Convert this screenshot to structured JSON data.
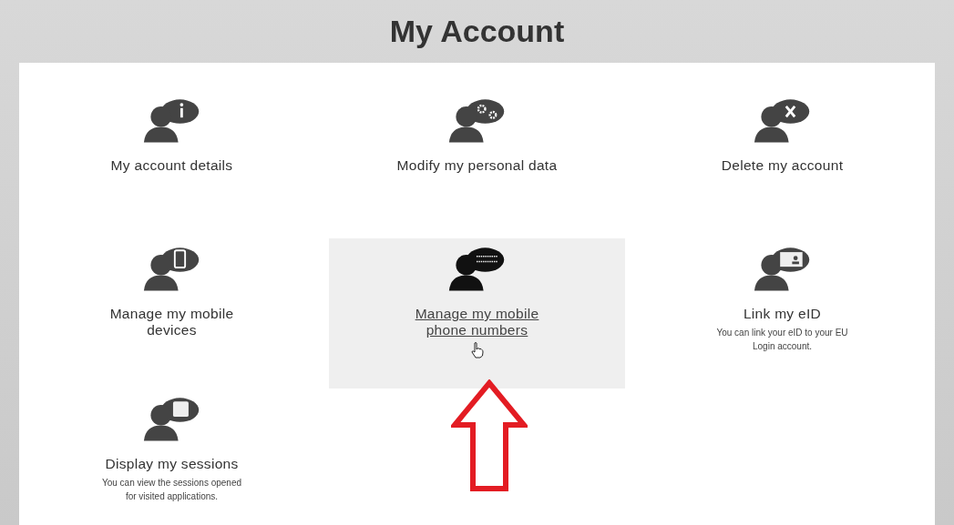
{
  "header": {
    "title": "My Account"
  },
  "tiles": [
    {
      "kind": "info",
      "title": "My account details",
      "selected": false
    },
    {
      "kind": "settings",
      "title": "Modify my personal data",
      "selected": false
    },
    {
      "kind": "delete",
      "title": "Delete my account",
      "selected": false
    },
    {
      "kind": "device",
      "title": "Manage my mobile devices",
      "selected": false
    },
    {
      "kind": "numbers",
      "title": "Manage my mobile phone numbers",
      "selected": true
    },
    {
      "kind": "card",
      "title": "Link my eID",
      "description": "You can link your eID to your EU Login account.",
      "selected": false
    },
    {
      "kind": "sessions",
      "title": "Display my sessions",
      "description": "You can view the sessions opened for visited applications.",
      "selected": false
    }
  ]
}
